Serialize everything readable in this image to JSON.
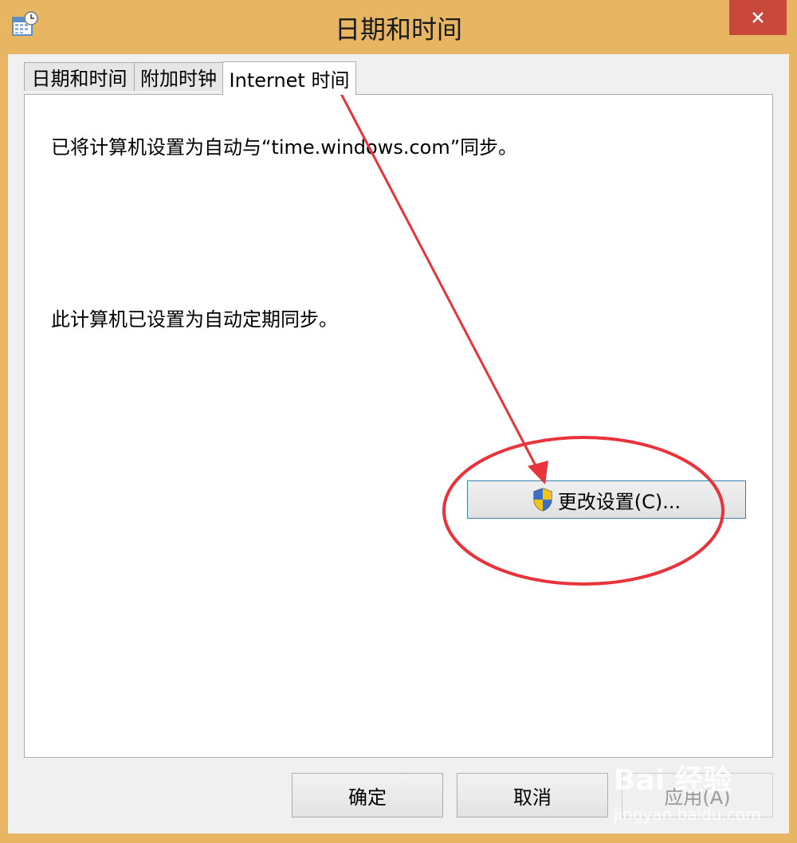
{
  "window": {
    "title": "日期和时间",
    "icon": "calendar-clock-icon",
    "close_icon": "close-icon",
    "title_bar_color": "#e8b563",
    "close_color": "#c9483c"
  },
  "tabs": [
    {
      "label": "日期和时间",
      "active": false
    },
    {
      "label": "附加时钟",
      "active": false
    },
    {
      "label": "Internet 时间",
      "active": true
    }
  ],
  "content": {
    "sync_server_text": "已将计算机设置为自动与“time.windows.com”同步。",
    "auto_sync_text": "此计算机已设置为自动定期同步。",
    "change_settings_label": "更改设置(C)...",
    "change_settings_icon": "uac-shield-icon"
  },
  "buttons": {
    "ok": "确定",
    "cancel": "取消",
    "apply": "应用(A)"
  },
  "annotation": {
    "color": "#e8333a"
  },
  "watermark": {
    "logo": "Bai 经验",
    "url": "jingyan.baidu.com"
  }
}
